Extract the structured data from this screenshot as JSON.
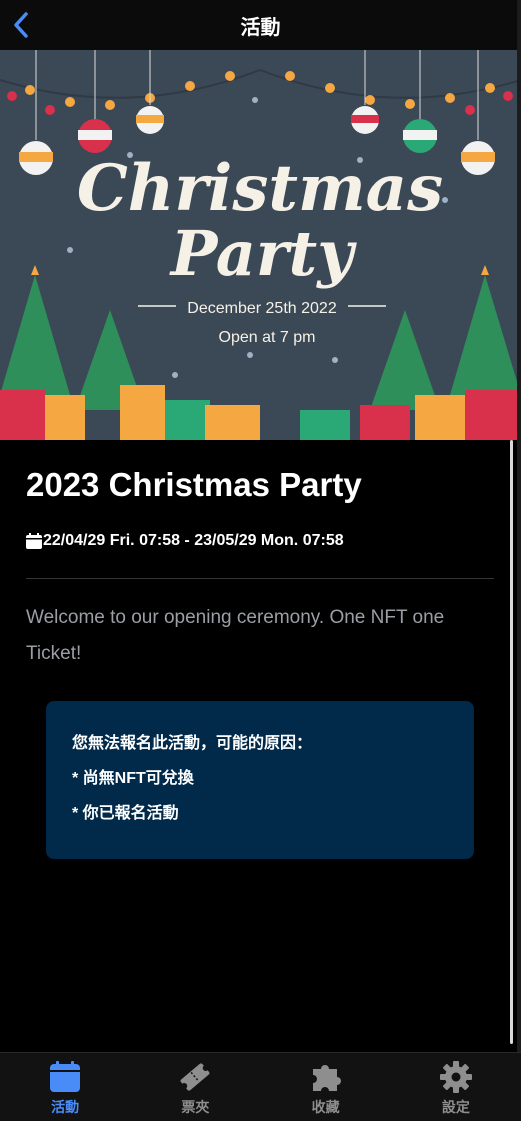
{
  "header": {
    "title": "活動"
  },
  "banner": {
    "title_line1": "Christmas",
    "title_line2": "Party",
    "date": "December 25th 2022",
    "open": "Open at 7 pm"
  },
  "event": {
    "title": "2023 Christmas Party",
    "datetime": "22/04/29 Fri. 07:58 - 23/05/29 Mon. 07:58",
    "description": "Welcome to our opening ceremony. One NFT one Ticket!"
  },
  "notice": {
    "heading": "您無法報名此活動，可能的原因：",
    "reasons": [
      "* 尚無NFT可兌換",
      "* 你已報名活動"
    ]
  },
  "tabs": [
    {
      "label": "活動",
      "icon": "calendar-icon",
      "active": true
    },
    {
      "label": "票夾",
      "icon": "ticket-icon",
      "active": false
    },
    {
      "label": "收藏",
      "icon": "puzzle-icon",
      "active": false
    },
    {
      "label": "設定",
      "icon": "gear-icon",
      "active": false
    }
  ],
  "colors": {
    "accent": "#4a8cf7",
    "inactive": "#8e8e8e",
    "notice_bg": "#00294a"
  }
}
